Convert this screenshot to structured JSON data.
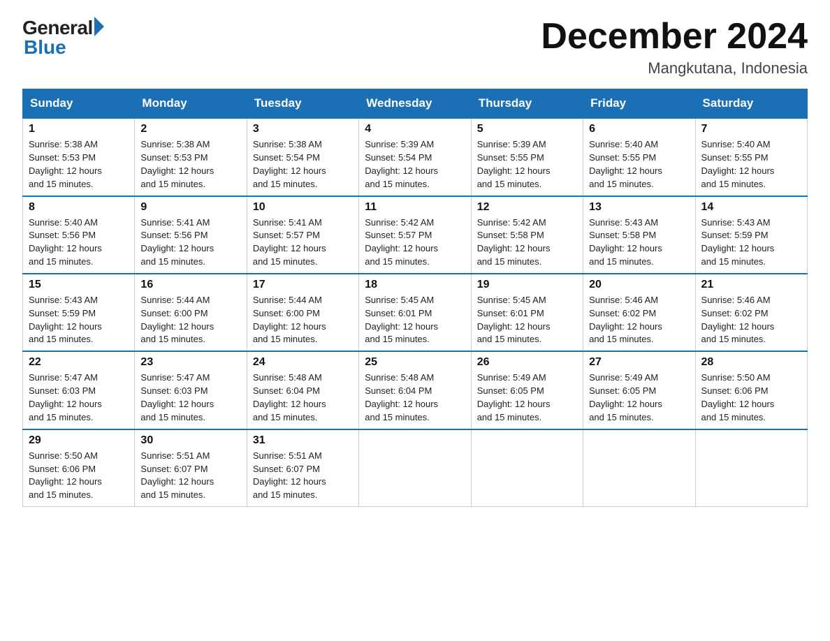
{
  "header": {
    "logo_general": "General",
    "logo_blue": "Blue",
    "month_title": "December 2024",
    "location": "Mangkutana, Indonesia"
  },
  "weekdays": [
    "Sunday",
    "Monday",
    "Tuesday",
    "Wednesday",
    "Thursday",
    "Friday",
    "Saturday"
  ],
  "weeks": [
    [
      {
        "day": "1",
        "sunrise": "5:38 AM",
        "sunset": "5:53 PM",
        "daylight": "12 hours and 15 minutes."
      },
      {
        "day": "2",
        "sunrise": "5:38 AM",
        "sunset": "5:53 PM",
        "daylight": "12 hours and 15 minutes."
      },
      {
        "day": "3",
        "sunrise": "5:38 AM",
        "sunset": "5:54 PM",
        "daylight": "12 hours and 15 minutes."
      },
      {
        "day": "4",
        "sunrise": "5:39 AM",
        "sunset": "5:54 PM",
        "daylight": "12 hours and 15 minutes."
      },
      {
        "day": "5",
        "sunrise": "5:39 AM",
        "sunset": "5:55 PM",
        "daylight": "12 hours and 15 minutes."
      },
      {
        "day": "6",
        "sunrise": "5:40 AM",
        "sunset": "5:55 PM",
        "daylight": "12 hours and 15 minutes."
      },
      {
        "day": "7",
        "sunrise": "5:40 AM",
        "sunset": "5:55 PM",
        "daylight": "12 hours and 15 minutes."
      }
    ],
    [
      {
        "day": "8",
        "sunrise": "5:40 AM",
        "sunset": "5:56 PM",
        "daylight": "12 hours and 15 minutes."
      },
      {
        "day": "9",
        "sunrise": "5:41 AM",
        "sunset": "5:56 PM",
        "daylight": "12 hours and 15 minutes."
      },
      {
        "day": "10",
        "sunrise": "5:41 AM",
        "sunset": "5:57 PM",
        "daylight": "12 hours and 15 minutes."
      },
      {
        "day": "11",
        "sunrise": "5:42 AM",
        "sunset": "5:57 PM",
        "daylight": "12 hours and 15 minutes."
      },
      {
        "day": "12",
        "sunrise": "5:42 AM",
        "sunset": "5:58 PM",
        "daylight": "12 hours and 15 minutes."
      },
      {
        "day": "13",
        "sunrise": "5:43 AM",
        "sunset": "5:58 PM",
        "daylight": "12 hours and 15 minutes."
      },
      {
        "day": "14",
        "sunrise": "5:43 AM",
        "sunset": "5:59 PM",
        "daylight": "12 hours and 15 minutes."
      }
    ],
    [
      {
        "day": "15",
        "sunrise": "5:43 AM",
        "sunset": "5:59 PM",
        "daylight": "12 hours and 15 minutes."
      },
      {
        "day": "16",
        "sunrise": "5:44 AM",
        "sunset": "6:00 PM",
        "daylight": "12 hours and 15 minutes."
      },
      {
        "day": "17",
        "sunrise": "5:44 AM",
        "sunset": "6:00 PM",
        "daylight": "12 hours and 15 minutes."
      },
      {
        "day": "18",
        "sunrise": "5:45 AM",
        "sunset": "6:01 PM",
        "daylight": "12 hours and 15 minutes."
      },
      {
        "day": "19",
        "sunrise": "5:45 AM",
        "sunset": "6:01 PM",
        "daylight": "12 hours and 15 minutes."
      },
      {
        "day": "20",
        "sunrise": "5:46 AM",
        "sunset": "6:02 PM",
        "daylight": "12 hours and 15 minutes."
      },
      {
        "day": "21",
        "sunrise": "5:46 AM",
        "sunset": "6:02 PM",
        "daylight": "12 hours and 15 minutes."
      }
    ],
    [
      {
        "day": "22",
        "sunrise": "5:47 AM",
        "sunset": "6:03 PM",
        "daylight": "12 hours and 15 minutes."
      },
      {
        "day": "23",
        "sunrise": "5:47 AM",
        "sunset": "6:03 PM",
        "daylight": "12 hours and 15 minutes."
      },
      {
        "day": "24",
        "sunrise": "5:48 AM",
        "sunset": "6:04 PM",
        "daylight": "12 hours and 15 minutes."
      },
      {
        "day": "25",
        "sunrise": "5:48 AM",
        "sunset": "6:04 PM",
        "daylight": "12 hours and 15 minutes."
      },
      {
        "day": "26",
        "sunrise": "5:49 AM",
        "sunset": "6:05 PM",
        "daylight": "12 hours and 15 minutes."
      },
      {
        "day": "27",
        "sunrise": "5:49 AM",
        "sunset": "6:05 PM",
        "daylight": "12 hours and 15 minutes."
      },
      {
        "day": "28",
        "sunrise": "5:50 AM",
        "sunset": "6:06 PM",
        "daylight": "12 hours and 15 minutes."
      }
    ],
    [
      {
        "day": "29",
        "sunrise": "5:50 AM",
        "sunset": "6:06 PM",
        "daylight": "12 hours and 15 minutes."
      },
      {
        "day": "30",
        "sunrise": "5:51 AM",
        "sunset": "6:07 PM",
        "daylight": "12 hours and 15 minutes."
      },
      {
        "day": "31",
        "sunrise": "5:51 AM",
        "sunset": "6:07 PM",
        "daylight": "12 hours and 15 minutes."
      },
      null,
      null,
      null,
      null
    ]
  ]
}
